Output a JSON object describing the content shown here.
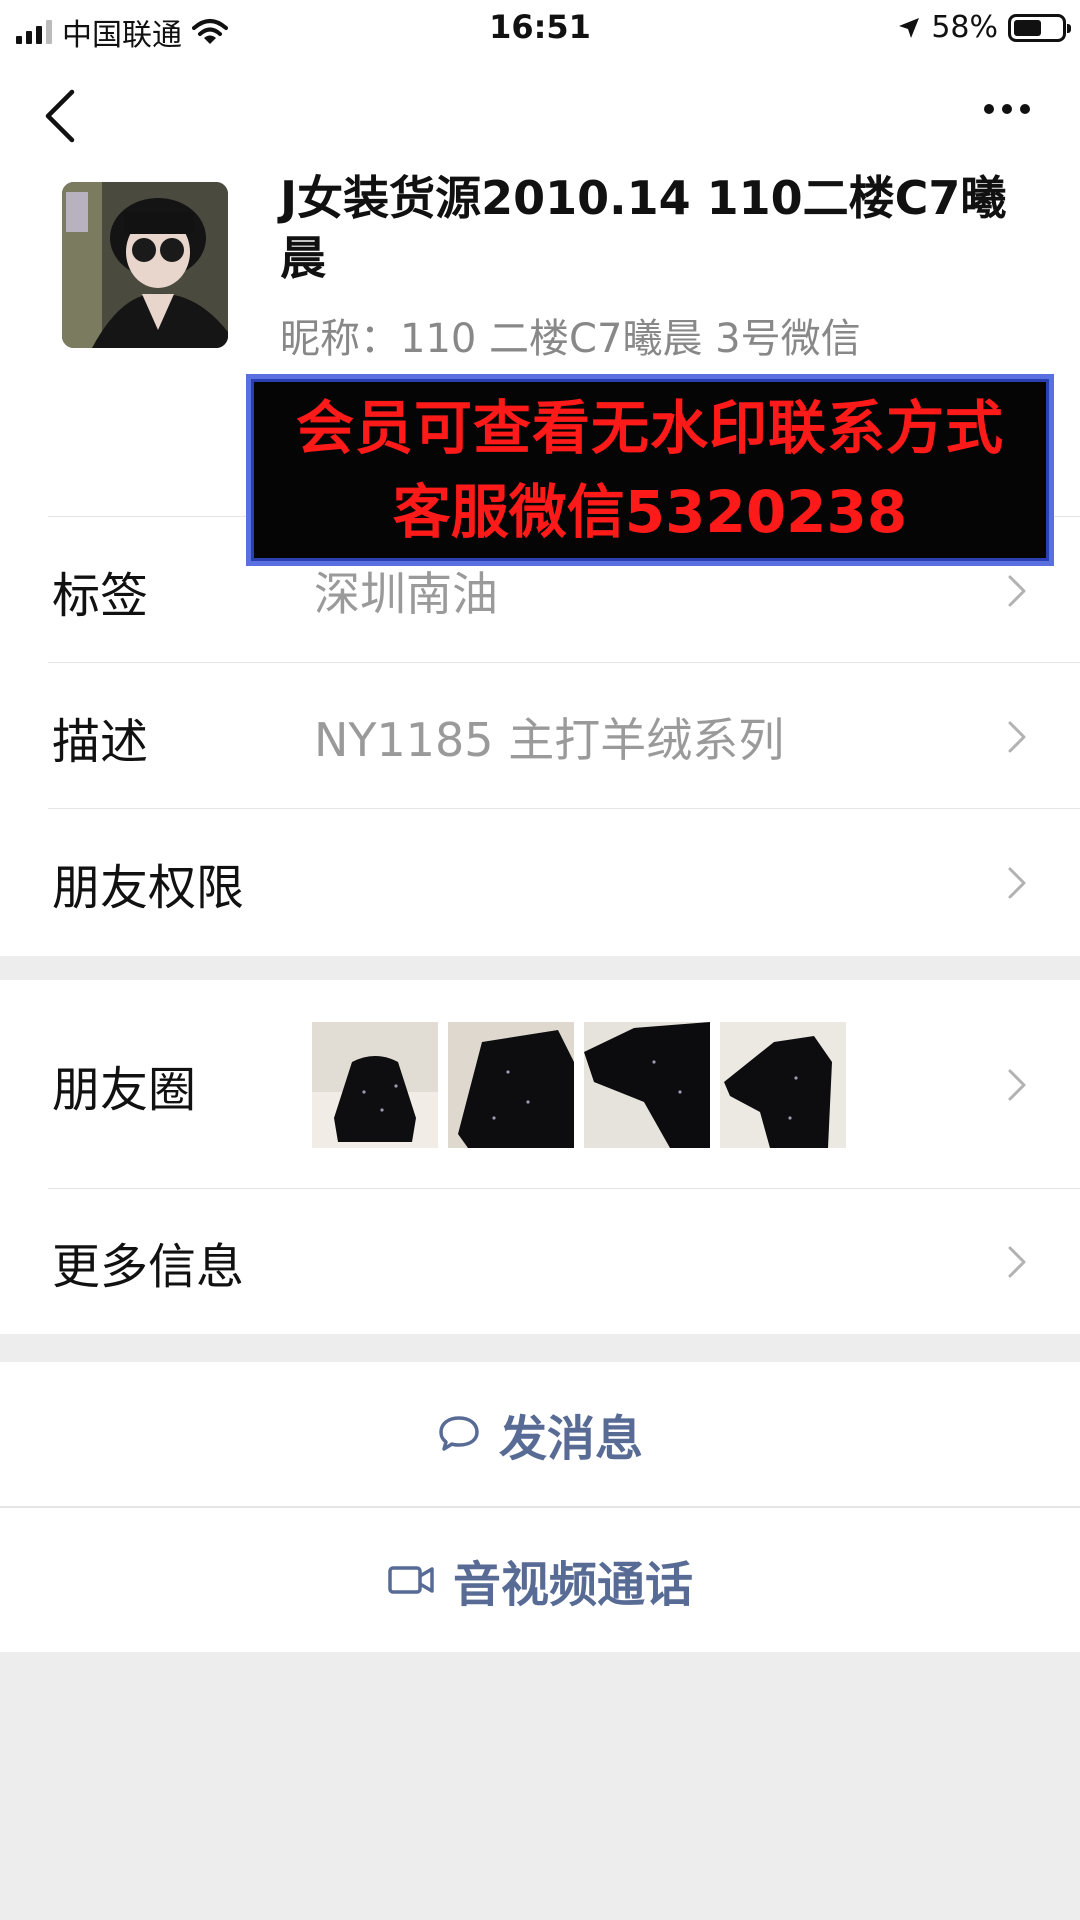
{
  "status_bar": {
    "carrier": "中国联通",
    "time": "16:51",
    "battery_pct": "58%",
    "battery_level": 0.58
  },
  "profile": {
    "name": "J女装货源2010.14 110二楼C7曦晨",
    "nickname": "昵称：110 二楼C7曦晨 3号微信"
  },
  "watermark": {
    "line1": "会员可查看无水印联系方式",
    "line2": "客服微信5320238"
  },
  "rows": [
    {
      "label": "标签",
      "value": "深圳南油"
    },
    {
      "label": "描述",
      "value": "NY1185 主打羊绒系列"
    },
    {
      "label": "朋友权限",
      "value": ""
    }
  ],
  "moments": {
    "label": "朋友圈"
  },
  "more_info": {
    "label": "更多信息"
  },
  "actions": {
    "message": "发消息",
    "call": "音视频通话"
  },
  "colors": {
    "link": "#576B95",
    "watermark_text": "#FF1A1A",
    "background": "#EDEDED"
  }
}
